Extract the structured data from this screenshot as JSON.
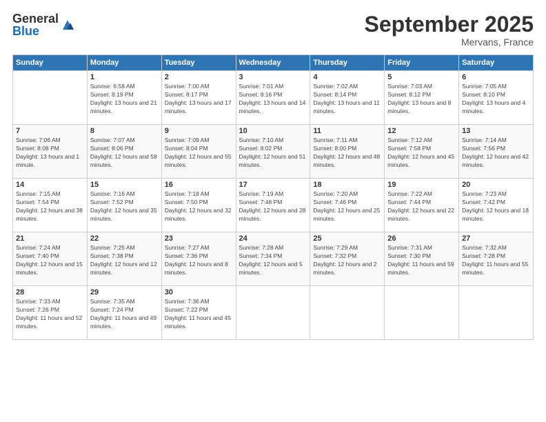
{
  "logo": {
    "general": "General",
    "blue": "Blue"
  },
  "title": "September 2025",
  "location": "Mervans, France",
  "headers": [
    "Sunday",
    "Monday",
    "Tuesday",
    "Wednesday",
    "Thursday",
    "Friday",
    "Saturday"
  ],
  "weeks": [
    [
      {
        "day": "",
        "sunrise": "",
        "sunset": "",
        "daylight": ""
      },
      {
        "day": "1",
        "sunrise": "Sunrise: 6:58 AM",
        "sunset": "Sunset: 8:19 PM",
        "daylight": "Daylight: 13 hours and 21 minutes."
      },
      {
        "day": "2",
        "sunrise": "Sunrise: 7:00 AM",
        "sunset": "Sunset: 8:17 PM",
        "daylight": "Daylight: 13 hours and 17 minutes."
      },
      {
        "day": "3",
        "sunrise": "Sunrise: 7:01 AM",
        "sunset": "Sunset: 8:16 PM",
        "daylight": "Daylight: 13 hours and 14 minutes."
      },
      {
        "day": "4",
        "sunrise": "Sunrise: 7:02 AM",
        "sunset": "Sunset: 8:14 PM",
        "daylight": "Daylight: 13 hours and 11 minutes."
      },
      {
        "day": "5",
        "sunrise": "Sunrise: 7:03 AM",
        "sunset": "Sunset: 8:12 PM",
        "daylight": "Daylight: 13 hours and 8 minutes."
      },
      {
        "day": "6",
        "sunrise": "Sunrise: 7:05 AM",
        "sunset": "Sunset: 8:10 PM",
        "daylight": "Daylight: 13 hours and 4 minutes."
      }
    ],
    [
      {
        "day": "7",
        "sunrise": "Sunrise: 7:06 AM",
        "sunset": "Sunset: 8:08 PM",
        "daylight": "Daylight: 13 hours and 1 minute."
      },
      {
        "day": "8",
        "sunrise": "Sunrise: 7:07 AM",
        "sunset": "Sunset: 8:06 PM",
        "daylight": "Daylight: 12 hours and 58 minutes."
      },
      {
        "day": "9",
        "sunrise": "Sunrise: 7:09 AM",
        "sunset": "Sunset: 8:04 PM",
        "daylight": "Daylight: 12 hours and 55 minutes."
      },
      {
        "day": "10",
        "sunrise": "Sunrise: 7:10 AM",
        "sunset": "Sunset: 8:02 PM",
        "daylight": "Daylight: 12 hours and 51 minutes."
      },
      {
        "day": "11",
        "sunrise": "Sunrise: 7:11 AM",
        "sunset": "Sunset: 8:00 PM",
        "daylight": "Daylight: 12 hours and 48 minutes."
      },
      {
        "day": "12",
        "sunrise": "Sunrise: 7:12 AM",
        "sunset": "Sunset: 7:58 PM",
        "daylight": "Daylight: 12 hours and 45 minutes."
      },
      {
        "day": "13",
        "sunrise": "Sunrise: 7:14 AM",
        "sunset": "Sunset: 7:56 PM",
        "daylight": "Daylight: 12 hours and 42 minutes."
      }
    ],
    [
      {
        "day": "14",
        "sunrise": "Sunrise: 7:15 AM",
        "sunset": "Sunset: 7:54 PM",
        "daylight": "Daylight: 12 hours and 38 minutes."
      },
      {
        "day": "15",
        "sunrise": "Sunrise: 7:16 AM",
        "sunset": "Sunset: 7:52 PM",
        "daylight": "Daylight: 12 hours and 35 minutes."
      },
      {
        "day": "16",
        "sunrise": "Sunrise: 7:18 AM",
        "sunset": "Sunset: 7:50 PM",
        "daylight": "Daylight: 12 hours and 32 minutes."
      },
      {
        "day": "17",
        "sunrise": "Sunrise: 7:19 AM",
        "sunset": "Sunset: 7:48 PM",
        "daylight": "Daylight: 12 hours and 28 minutes."
      },
      {
        "day": "18",
        "sunrise": "Sunrise: 7:20 AM",
        "sunset": "Sunset: 7:46 PM",
        "daylight": "Daylight: 12 hours and 25 minutes."
      },
      {
        "day": "19",
        "sunrise": "Sunrise: 7:22 AM",
        "sunset": "Sunset: 7:44 PM",
        "daylight": "Daylight: 12 hours and 22 minutes."
      },
      {
        "day": "20",
        "sunrise": "Sunrise: 7:23 AM",
        "sunset": "Sunset: 7:42 PM",
        "daylight": "Daylight: 12 hours and 18 minutes."
      }
    ],
    [
      {
        "day": "21",
        "sunrise": "Sunrise: 7:24 AM",
        "sunset": "Sunset: 7:40 PM",
        "daylight": "Daylight: 12 hours and 15 minutes."
      },
      {
        "day": "22",
        "sunrise": "Sunrise: 7:25 AM",
        "sunset": "Sunset: 7:38 PM",
        "daylight": "Daylight: 12 hours and 12 minutes."
      },
      {
        "day": "23",
        "sunrise": "Sunrise: 7:27 AM",
        "sunset": "Sunset: 7:36 PM",
        "daylight": "Daylight: 12 hours and 8 minutes."
      },
      {
        "day": "24",
        "sunrise": "Sunrise: 7:28 AM",
        "sunset": "Sunset: 7:34 PM",
        "daylight": "Daylight: 12 hours and 5 minutes."
      },
      {
        "day": "25",
        "sunrise": "Sunrise: 7:29 AM",
        "sunset": "Sunset: 7:32 PM",
        "daylight": "Daylight: 12 hours and 2 minutes."
      },
      {
        "day": "26",
        "sunrise": "Sunrise: 7:31 AM",
        "sunset": "Sunset: 7:30 PM",
        "daylight": "Daylight: 11 hours and 59 minutes."
      },
      {
        "day": "27",
        "sunrise": "Sunrise: 7:32 AM",
        "sunset": "Sunset: 7:28 PM",
        "daylight": "Daylight: 11 hours and 55 minutes."
      }
    ],
    [
      {
        "day": "28",
        "sunrise": "Sunrise: 7:33 AM",
        "sunset": "Sunset: 7:26 PM",
        "daylight": "Daylight: 11 hours and 52 minutes."
      },
      {
        "day": "29",
        "sunrise": "Sunrise: 7:35 AM",
        "sunset": "Sunset: 7:24 PM",
        "daylight": "Daylight: 11 hours and 49 minutes."
      },
      {
        "day": "30",
        "sunrise": "Sunrise: 7:36 AM",
        "sunset": "Sunset: 7:22 PM",
        "daylight": "Daylight: 11 hours and 45 minutes."
      },
      {
        "day": "",
        "sunrise": "",
        "sunset": "",
        "daylight": ""
      },
      {
        "day": "",
        "sunrise": "",
        "sunset": "",
        "daylight": ""
      },
      {
        "day": "",
        "sunrise": "",
        "sunset": "",
        "daylight": ""
      },
      {
        "day": "",
        "sunrise": "",
        "sunset": "",
        "daylight": ""
      }
    ]
  ]
}
